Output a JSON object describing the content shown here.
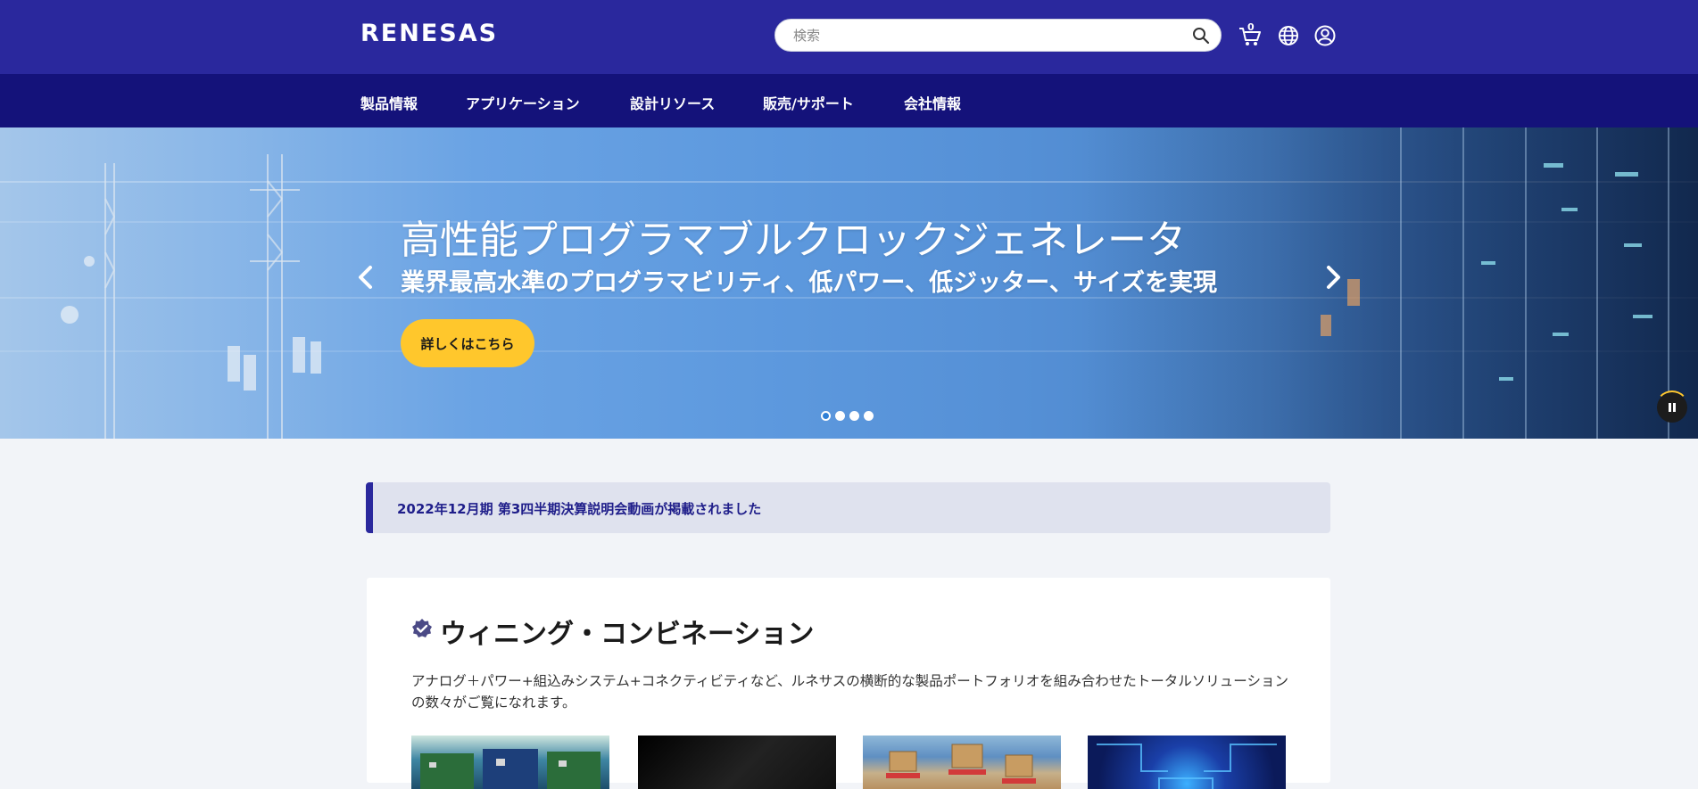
{
  "header": {
    "logo": "RENESAS",
    "search": {
      "placeholder": "検索"
    },
    "cart_count": "0",
    "icons": [
      "search-icon",
      "cart-icon",
      "globe-icon",
      "user-icon"
    ]
  },
  "nav": {
    "items": [
      "製品情報",
      "アプリケーション",
      "設計リソース",
      "販売/サポート",
      "会社情報"
    ]
  },
  "hero": {
    "title": "高性能プログラマブルクロックジェネレータ",
    "subtitle": "業界最高水準のプログラマビリティ、低パワー、低ジッター、サイズを実現",
    "cta": "詳しくはこちら",
    "slides": 4,
    "active_slide": 1
  },
  "notice": {
    "text": "2022年12月期 第3四半期決算説明会動画が掲載されました"
  },
  "section": {
    "title": "ウィニング・コンビネーション",
    "description": "アナログ＋パワー+組込みシステム+コネクティビティなど、ルネサスの横断的な製品ポートフォリオを組み合わせたトータルソリューションの数々がご覧になれます。"
  },
  "colors": {
    "header_bg": "#2a289d",
    "nav_bg": "#14127a",
    "cta": "#ffc72c",
    "page_bg": "#f2f4f8"
  }
}
